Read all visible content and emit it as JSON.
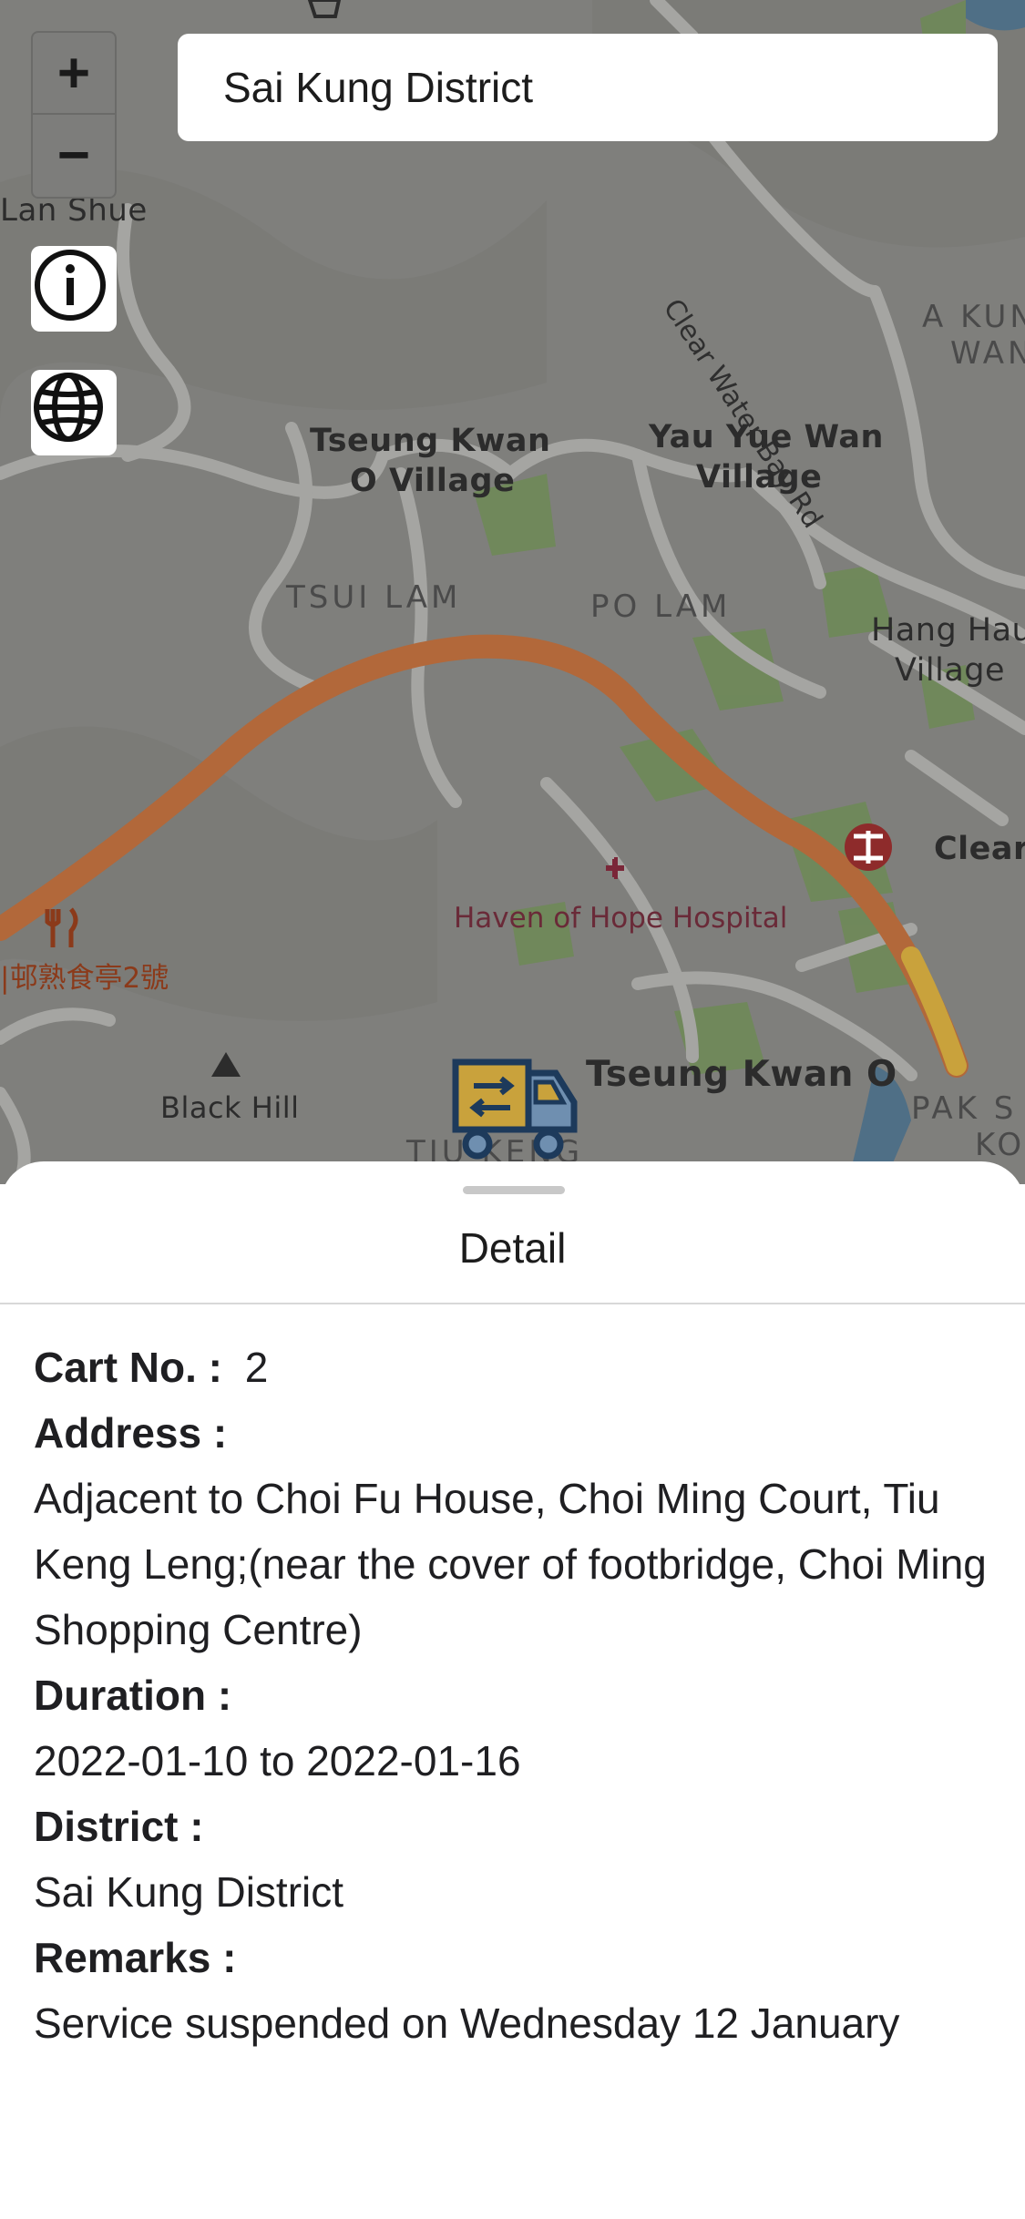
{
  "search": {
    "value": "Sai Kung District"
  },
  "map": {
    "controls": {
      "zoom_in": "+",
      "zoom_out": "−",
      "info_icon": "info-icon",
      "language_icon": "globe-icon"
    },
    "labels": {
      "lan_shue": "Lan Shue",
      "clear_water_bay_rd": "Clear Water Bay Rd",
      "a_kung_wan_1": "A KUN",
      "a_kung_wan_2": "WAN",
      "tseung_kwan_o_village_1": "Tseung Kwan",
      "tseung_kwan_o_village_2": "O Village",
      "yau_yue_wan_village_1": "Yau Yue Wan",
      "yau_yue_wan_village_2": "Village",
      "tsui_lam": "TSUI LAM",
      "po_lam": "PO LAM",
      "hang_hau_village_1": "Hang Hau",
      "hang_hau_village_2": "Village",
      "clear": "Clear",
      "haven_of_hope_hospital": "Haven of Hope Hospital",
      "cooked_food_kiosk": "|邨熟食亭2號",
      "black_hill": "Black Hill",
      "tseung_kwan_o": "Tseung Kwan O",
      "pak_shing_kok_1": "PAK S",
      "pak_shing_kok_2": "KO",
      "tiu_keng": "TIU KENG"
    },
    "colors": {
      "land": "#7f7f7c",
      "road": "#a4a4a1",
      "highway": "#b56a3c",
      "park": "#6f8b58"
    }
  },
  "detail": {
    "handle_icon": "drag-handle",
    "title": "Detail",
    "cart_no_label": "Cart No. :",
    "cart_no_value": "2",
    "address_label": "Address :",
    "address_value": "Adjacent to Choi Fu House, Choi Ming Court, Tiu Keng Leng;(near the cover of footbridge, Choi Ming Shopping Centre)",
    "duration_label": "Duration :",
    "duration_value": "2022-01-10 to 2022-01-16",
    "district_label": "District :",
    "district_value": "Sai Kung District",
    "remarks_label": "Remarks :",
    "remarks_value": "Service suspended on Wednesday 12 January"
  }
}
